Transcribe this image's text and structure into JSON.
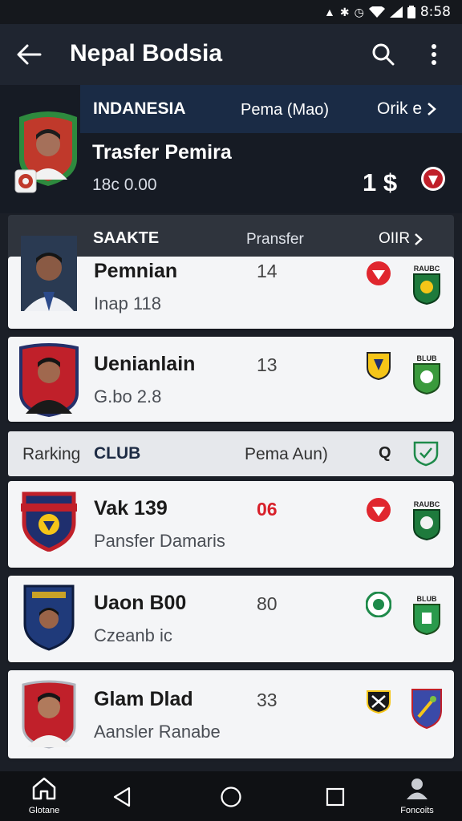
{
  "status": {
    "time": "8:58"
  },
  "appbar": {
    "title": "Nepal Bodsia"
  },
  "feature": {
    "country": "INDANESIA",
    "column": "Pema (Mao)",
    "link": "Orik e",
    "name": "Trasfer Pemira",
    "value": "18c 0.00",
    "amount": "1 $"
  },
  "list_header": {
    "title": "SAAKTE",
    "column": "Pransfer",
    "link": "OIIR"
  },
  "cards_top": [
    {
      "name": "Pemnian",
      "sub": "Inap 118",
      "num": "14",
      "badge": "RAUBC"
    },
    {
      "name": "Uenianlain",
      "sub": "G.bo 2.8",
      "num": "13",
      "badge": "BLUB"
    }
  ],
  "filter": {
    "label": "Rarking",
    "club": "CLUB",
    "column": "Pema Aun)",
    "q": "Q"
  },
  "cards_bottom": [
    {
      "name": "Vak 139",
      "sub": "Pansfer Damaris",
      "num": "06",
      "badge": "RAUBC"
    },
    {
      "name": "Uaon B00",
      "sub": "Czeanb ic",
      "num": "80",
      "badge": "BLUB"
    },
    {
      "name": "Glam Dlad",
      "sub": "Aansler Ranabe",
      "num": "33",
      "badge": ""
    }
  ],
  "navbar": {
    "home_label": "Glotane",
    "account_label": "Foncoits"
  },
  "colors": {
    "appbar": "#1f2530",
    "band": "#1a2b45",
    "accent_red": "#d8202a",
    "badge_green": "#1e7a3c"
  }
}
